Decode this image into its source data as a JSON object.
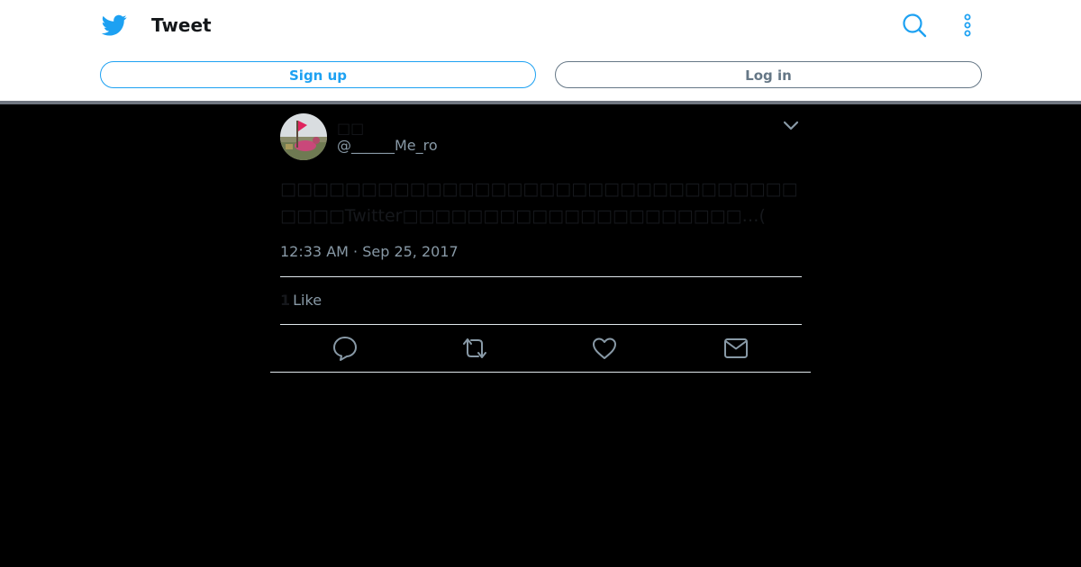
{
  "header": {
    "title": "Tweet",
    "signup_label": "Sign up",
    "login_label": "Log in",
    "icons": [
      "twitter-bird-icon",
      "search-icon",
      "more-vertical-icon"
    ],
    "accent": "#1da1f2"
  },
  "tweet": {
    "display_name": "□□",
    "handle": "@______Me_ro",
    "text": "□□□□□□□□□□□□□□□□□□□□□□□□□□□□□□□□□□□□Twitter□□□□□□□□□□□□□□□□□□□□□…(",
    "timestamp": "12:33 AM · Sep 25, 2017",
    "like_count": "1",
    "like_label": "Like",
    "actions": [
      "reply-icon",
      "retweet-icon",
      "like-icon",
      "direct-message-icon"
    ]
  },
  "colors": {
    "background": "#000000",
    "muted_text": "#8899a6",
    "dark_text": "#16181c"
  }
}
